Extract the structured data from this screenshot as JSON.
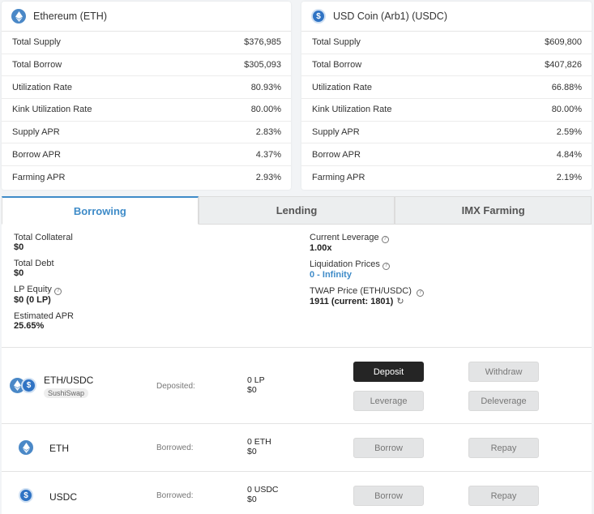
{
  "eth_card": {
    "title": "Ethereum (ETH)",
    "rows": [
      {
        "label": "Total Supply",
        "value": "$376,985"
      },
      {
        "label": "Total Borrow",
        "value": "$305,093"
      },
      {
        "label": "Utilization Rate",
        "value": "80.93%"
      },
      {
        "label": "Kink Utilization Rate",
        "value": "80.00%"
      },
      {
        "label": "Supply APR",
        "value": "2.83%"
      },
      {
        "label": "Borrow APR",
        "value": "4.37%"
      },
      {
        "label": "Farming APR",
        "value": "2.93%"
      }
    ]
  },
  "usdc_card": {
    "title": "USD Coin (Arb1) (USDC)",
    "rows": [
      {
        "label": "Total Supply",
        "value": "$609,800"
      },
      {
        "label": "Total Borrow",
        "value": "$407,826"
      },
      {
        "label": "Utilization Rate",
        "value": "66.88%"
      },
      {
        "label": "Kink Utilization Rate",
        "value": "80.00%"
      },
      {
        "label": "Supply APR",
        "value": "2.59%"
      },
      {
        "label": "Borrow APR",
        "value": "4.84%"
      },
      {
        "label": "Farming APR",
        "value": "2.19%"
      }
    ]
  },
  "tabs": [
    {
      "label": "Borrowing",
      "active": true
    },
    {
      "label": "Lending",
      "active": false
    },
    {
      "label": "IMX Farming",
      "active": false
    }
  ],
  "summary": {
    "total_collateral_label": "Total Collateral",
    "total_collateral_value": "$0",
    "total_debt_label": "Total Debt",
    "total_debt_value": "$0",
    "lp_equity_label": "LP Equity",
    "lp_equity_value": "$0 (0 LP)",
    "estimated_apr_label": "Estimated APR",
    "estimated_apr_value": "25.65%",
    "current_leverage_label": "Current Leverage",
    "current_leverage_value": "1.00x",
    "liquidation_prices_label": "Liquidation Prices",
    "liquidation_prices_value": "0 - Infinity",
    "twap_label": "TWAP Price (ETH/USDC)",
    "twap_value": "1911 (current: 1801)"
  },
  "positions": {
    "lp": {
      "name": "ETH/USDC",
      "badge": "SushiSwap",
      "status_label": "Deposited:",
      "amount_line1": "0 LP",
      "amount_line2": "$0",
      "deposit_label": "Deposit",
      "withdraw_label": "Withdraw",
      "leverage_label": "Leverage",
      "deleverage_label": "Deleverage"
    },
    "eth": {
      "name": "ETH",
      "status_label": "Borrowed:",
      "amount_line1": "0 ETH",
      "amount_line2": "$0",
      "borrow_label": "Borrow",
      "repay_label": "Repay"
    },
    "usdc": {
      "name": "USDC",
      "status_label": "Borrowed:",
      "amount_line1": "0 USDC",
      "amount_line2": "$0",
      "borrow_label": "Borrow",
      "repay_label": "Repay"
    }
  },
  "icons": {
    "eth": "ethereum-icon",
    "usdc": "usdc-icon",
    "help": "question-circle-icon",
    "refresh": "refresh-icon"
  },
  "colors": {
    "accent": "#3e8bc8",
    "primary_button": "#252525",
    "eth_icon": "#4a88c7",
    "usdc_icon": "#2f73c4"
  }
}
